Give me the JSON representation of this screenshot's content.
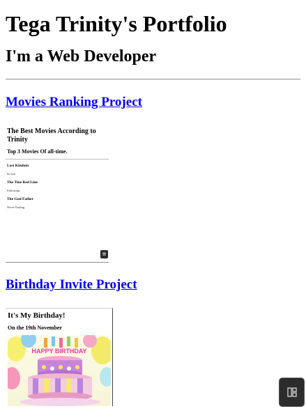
{
  "header": {
    "name": "Tega Trinity's Portfolio",
    "role": "I'm a Web Developer"
  },
  "projects": [
    {
      "title": "Movies Ranking Project",
      "preview": {
        "title": "The Best Movies According to Trinity",
        "subtitle": "Top 3 Movies Of all-time.",
        "items": [
          {
            "name": "Last Kindom",
            "desc": "So fun"
          },
          {
            "name": "The Tine Red Line",
            "desc": "Educating"
          },
          {
            "name": "The God Father",
            "desc": "Never Ending"
          }
        ]
      }
    },
    {
      "title": "Birthday Invite Project",
      "preview": {
        "title": "It's My Birthday!",
        "subtitle": "On the 19th November",
        "cake_text": "HAPPY BIRTHDAY"
      }
    }
  ],
  "colors": {
    "link": "#0000ee",
    "widget_bg": "#2c2c2c"
  },
  "icons": {
    "widget": "layout-icon"
  }
}
